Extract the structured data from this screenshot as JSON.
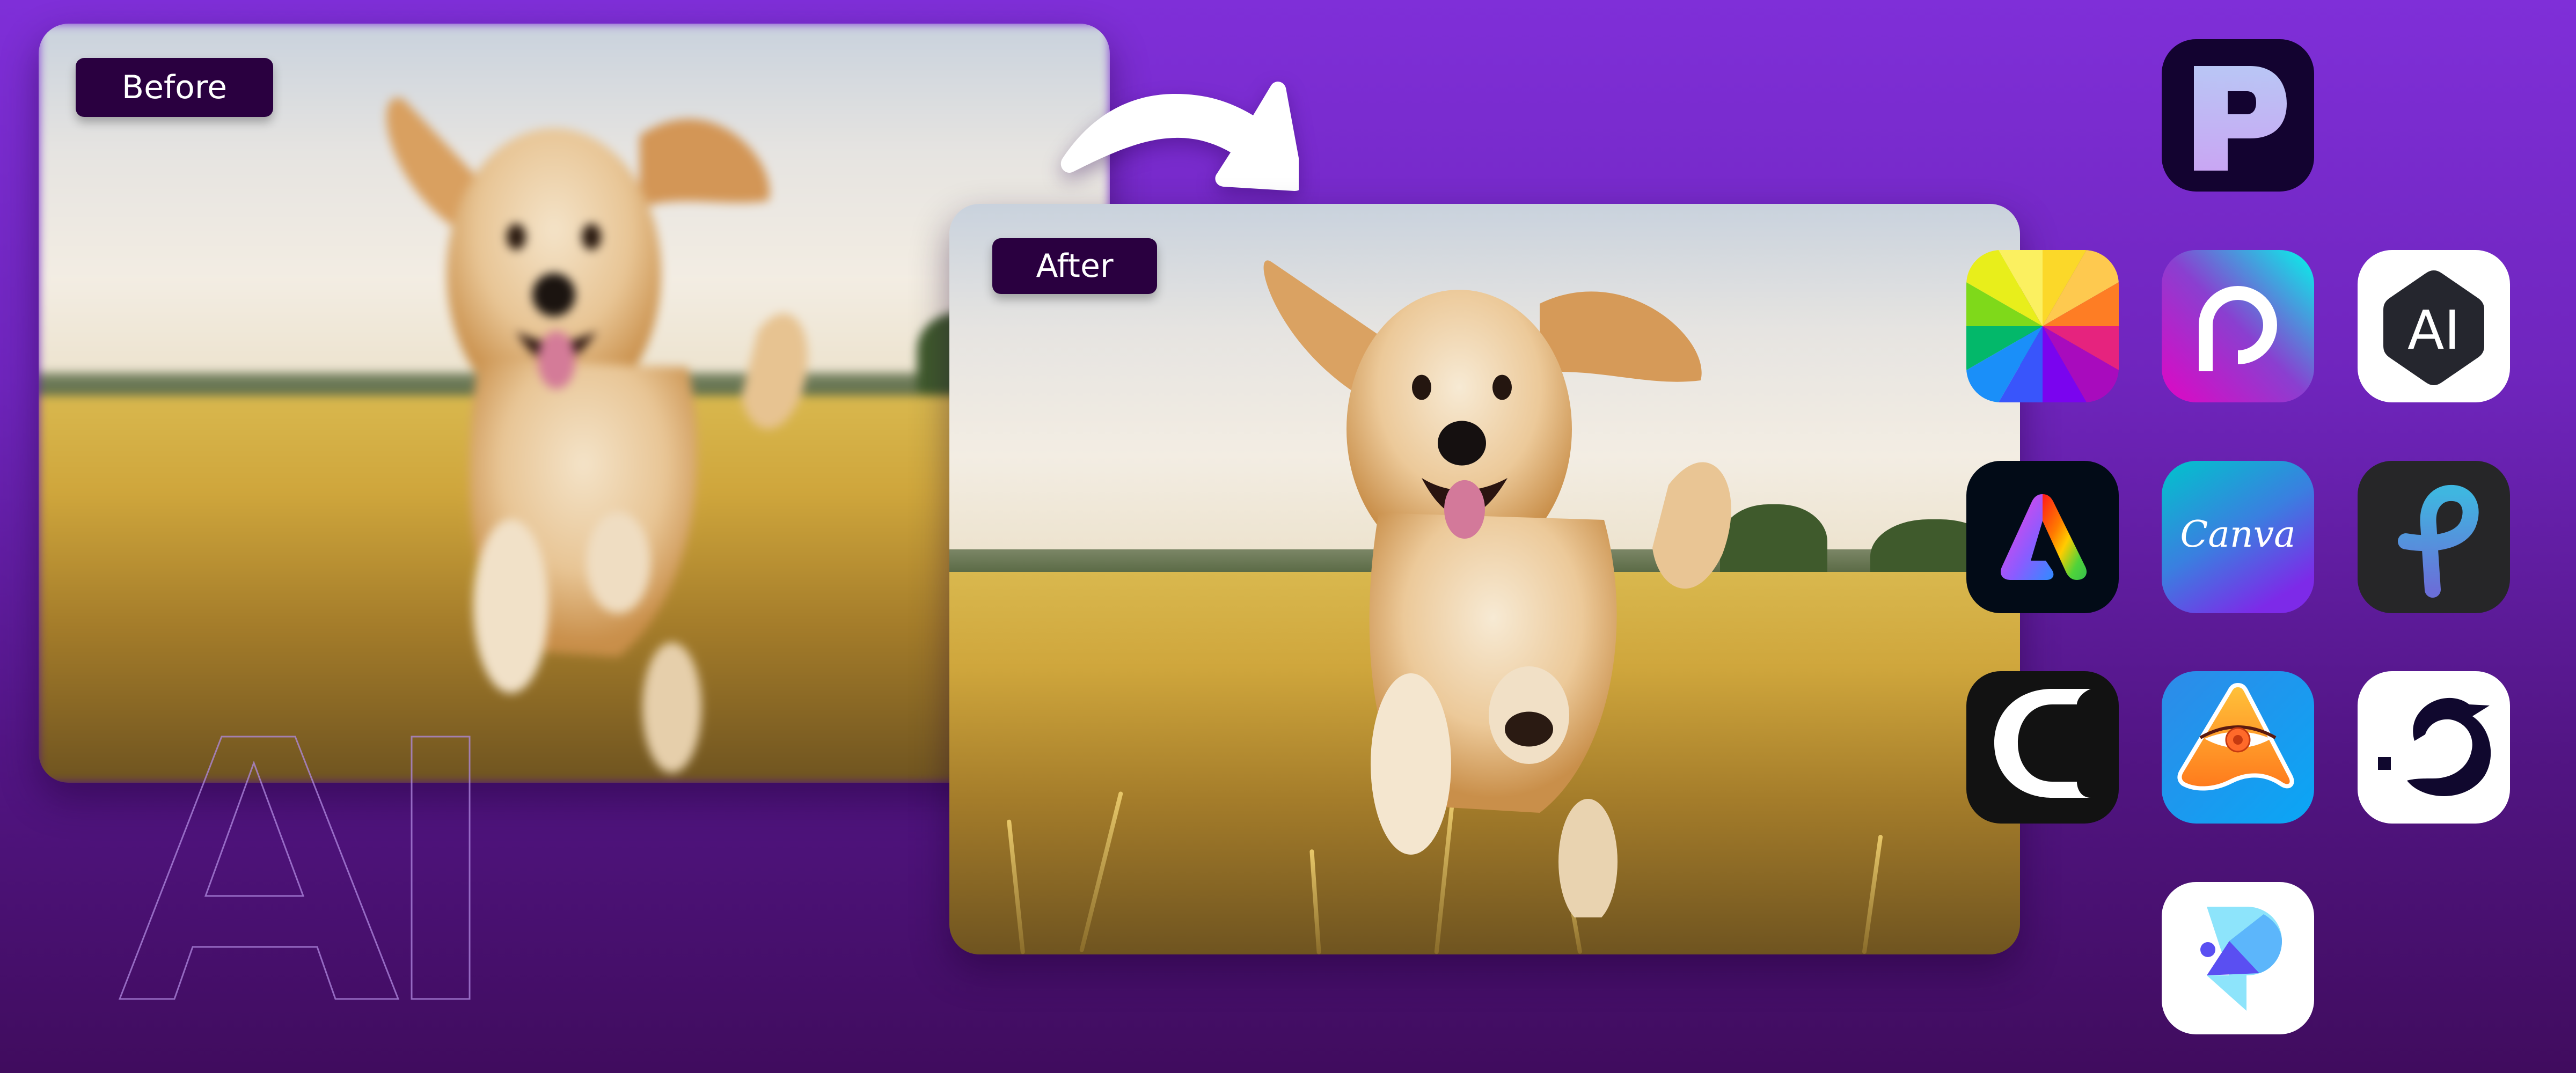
{
  "labels": {
    "before": "Before",
    "after": "After"
  },
  "watermark": {
    "text": "AI"
  },
  "transition": {
    "icon": "curved-arrow-right-icon"
  },
  "colors": {
    "background_top": "#7f2fd8",
    "background_bottom": "#400c5e",
    "label_bg": "#2a0040",
    "label_text": "#ffffff",
    "arrow": "#ffffff",
    "outline_text": "#b08ae0"
  },
  "images": {
    "before": {
      "description": "Blurry photo of a golden retriever puppy running through a wheat field",
      "state": "blurred"
    },
    "after": {
      "description": "Sharp photo of a golden retriever puppy running through a wheat field",
      "state": "enhanced"
    }
  },
  "app_icons": [
    {
      "name": "picsart-p-icon",
      "app": "PhotoDirector P",
      "row": 1,
      "col": 2
    },
    {
      "name": "fotor-icon",
      "app": "Fotor",
      "row": 2,
      "col": 1
    },
    {
      "name": "picsart-icon",
      "app": "Picsart",
      "row": 2,
      "col": 2
    },
    {
      "name": "ai-hexagon-icon",
      "app": "AI",
      "glyph": "AI",
      "row": 2,
      "col": 3
    },
    {
      "name": "adobe-express-icon",
      "app": "Adobe Express",
      "row": 3,
      "col": 1
    },
    {
      "name": "canva-icon",
      "app": "Canva",
      "glyph": "Canva",
      "row": 3,
      "col": 2
    },
    {
      "name": "pixlr-icon",
      "app": "Pixlr",
      "row": 3,
      "col": 3
    },
    {
      "name": "capcut-c-icon",
      "app": "C",
      "row": 4,
      "col": 1
    },
    {
      "name": "eye-triangle-icon",
      "app": "Photo AI",
      "row": 4,
      "col": 2
    },
    {
      "name": "dolphin-icon",
      "app": "Dolphin",
      "row": 4,
      "col": 3
    },
    {
      "name": "photo-p-bird-icon",
      "app": "Photo P",
      "row": 5,
      "col": 2
    }
  ]
}
